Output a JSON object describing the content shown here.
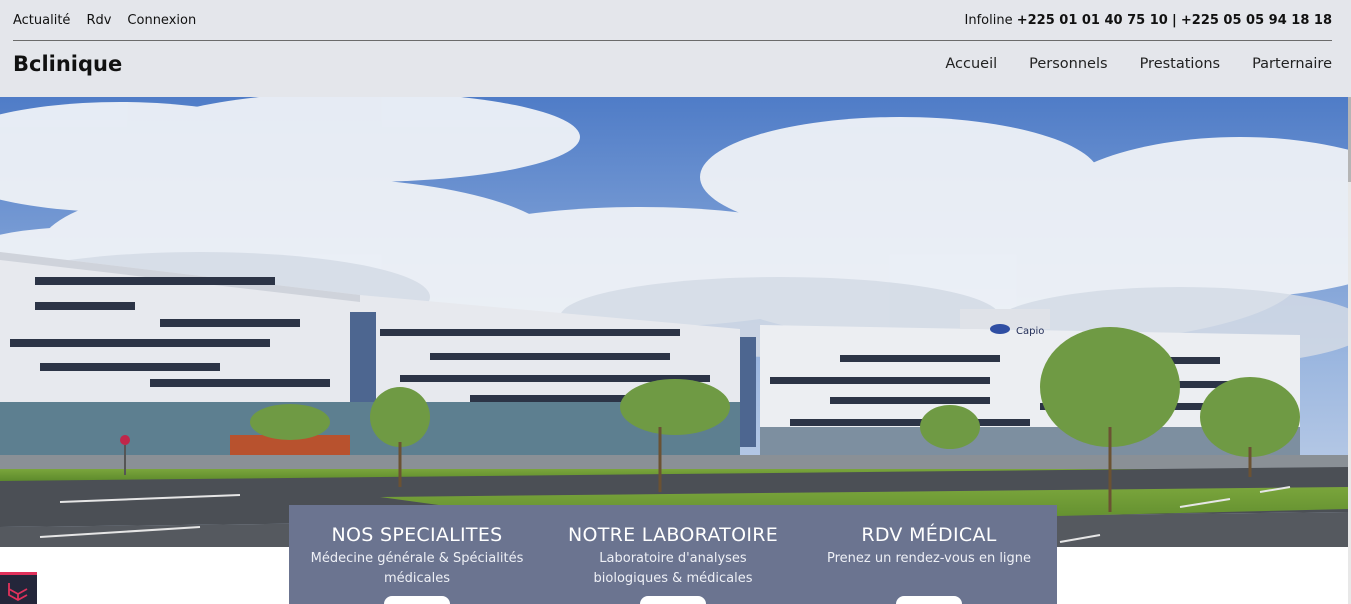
{
  "topbar": {
    "links": [
      "Actualité",
      "Rdv",
      "Connexion"
    ],
    "infoline_label": "Infoline",
    "phone_1": "+225 01 01 40 75 10",
    "separator": "|",
    "phone_2": "+225 05 05 94 18 18"
  },
  "brand": "Bclinique",
  "nav": [
    "Accueil",
    "Personnels",
    "Prestations",
    "Parternaire"
  ],
  "hero": {
    "image": "clinic-building-photo",
    "sign_text": "Capio"
  },
  "features": [
    {
      "title": "NOS SPECIALITES",
      "text": "Médecine générale & Spécialités médicales"
    },
    {
      "title": "NOTRE LABORATOIRE",
      "text": "Laboratoire d'analyses biologiques & médicales"
    },
    {
      "title": "RDV MÉDICAL",
      "text": "Prenez un rendez-vous en ligne"
    }
  ],
  "colors": {
    "topbar_bg": "#e4e6eb",
    "panel_bg": "#6b7490",
    "corner_accent": "#e0315b"
  }
}
